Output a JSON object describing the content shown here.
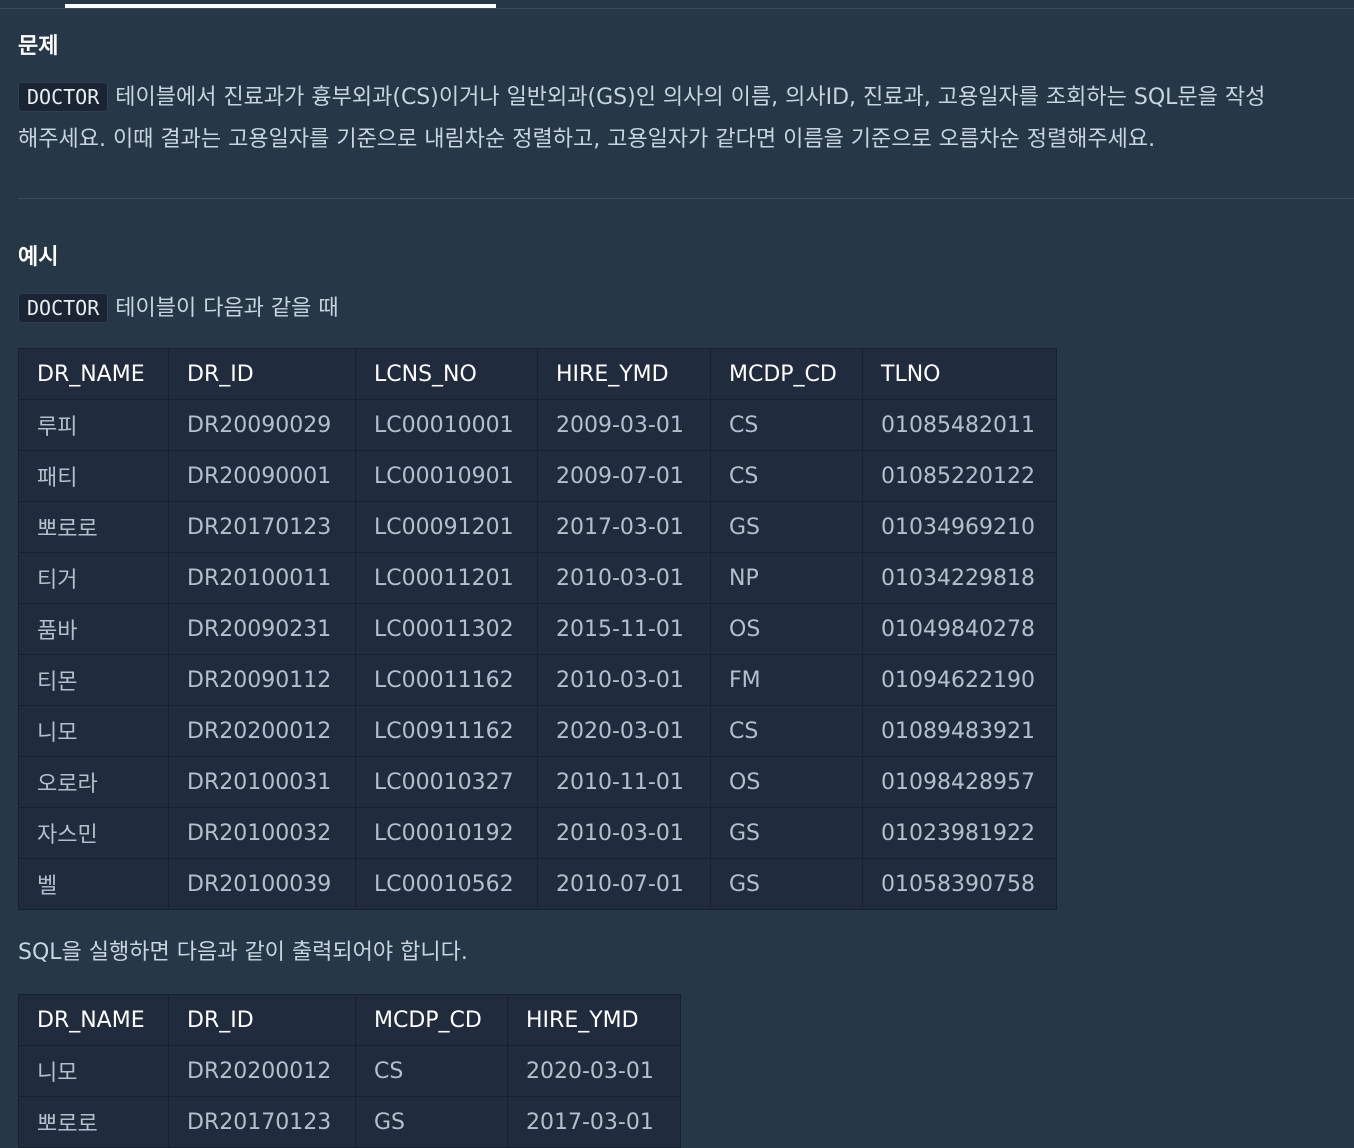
{
  "problem": {
    "heading": "문제",
    "code_tag": "DOCTOR",
    "line1_rest": "테이블에서 진료과가 흉부외과(CS)이거나 일반외과(GS)인 의사의 이름, 의사ID, 진료과, 고용일자를 조회하는 SQL문을 작성",
    "line2": "해주세요. 이때 결과는 고용일자를 기준으로 내림차순 정렬하고, 고용일자가 같다면 이름을 기준으로 오름차순 정렬해주세요."
  },
  "example": {
    "heading": "예시",
    "code_tag": "DOCTOR",
    "intro_rest": "테이블이 다음과 같을 때",
    "table": {
      "headers": [
        "DR_NAME",
        "DR_ID",
        "LCNS_NO",
        "HIRE_YMD",
        "MCDP_CD",
        "TLNO"
      ],
      "rows": [
        [
          "루피",
          "DR20090029",
          "LC00010001",
          "2009-03-01",
          "CS",
          "01085482011"
        ],
        [
          "패티",
          "DR20090001",
          "LC00010901",
          "2009-07-01",
          "CS",
          "01085220122"
        ],
        [
          "뽀로로",
          "DR20170123",
          "LC00091201",
          "2017-03-01",
          "GS",
          "01034969210"
        ],
        [
          "티거",
          "DR20100011",
          "LC00011201",
          "2010-03-01",
          "NP",
          "01034229818"
        ],
        [
          "품바",
          "DR20090231",
          "LC00011302",
          "2015-11-01",
          "OS",
          "01049840278"
        ],
        [
          "티몬",
          "DR20090112",
          "LC00011162",
          "2010-03-01",
          "FM",
          "01094622190"
        ],
        [
          "니모",
          "DR20200012",
          "LC00911162",
          "2020-03-01",
          "CS",
          "01089483921"
        ],
        [
          "오로라",
          "DR20100031",
          "LC00010327",
          "2010-11-01",
          "OS",
          "01098428957"
        ],
        [
          "자스민",
          "DR20100032",
          "LC00010192",
          "2010-03-01",
          "GS",
          "01023981922"
        ],
        [
          "벨",
          "DR20100039",
          "LC00010562",
          "2010-07-01",
          "GS",
          "01058390758"
        ]
      ]
    },
    "result_intro": "SQL을 실행하면 다음과 같이 출력되어야 합니다.",
    "result_table": {
      "headers": [
        "DR_NAME",
        "DR_ID",
        "MCDP_CD",
        "HIRE_YMD"
      ],
      "rows": [
        [
          "니모",
          "DR20200012",
          "CS",
          "2020-03-01"
        ],
        [
          "뽀로로",
          "DR20170123",
          "GS",
          "2017-03-01"
        ]
      ]
    }
  }
}
